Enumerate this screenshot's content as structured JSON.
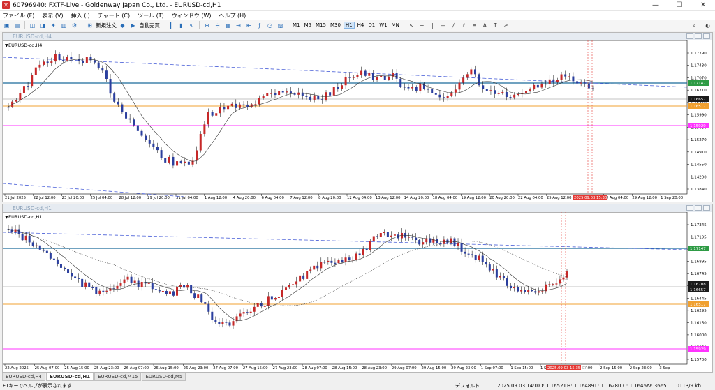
{
  "window": {
    "title": "60796940: FXTF-Live - Goldenway Japan Co., Ltd. - EURUSD-cd,H1",
    "controls": [
      "—",
      "☐",
      "✕"
    ]
  },
  "menu": [
    "ファイル (F)",
    "表示 (V)",
    "挿入 (I)",
    "チャート (C)",
    "ツール (T)",
    "ウィンドウ (W)",
    "ヘルプ (H)"
  ],
  "toolbar": {
    "new_order": "新規注文",
    "auto_trade": "自動売買",
    "timeframes": [
      "M1",
      "M5",
      "M15",
      "M30",
      "H1",
      "H4",
      "D1",
      "W1",
      "MN"
    ],
    "active_timeframe": "H1"
  },
  "colors": {
    "bull": "#c62828",
    "bear": "#2b3f9e",
    "resistance": "#1a6b9a",
    "support_orange": "#f0a030",
    "support_magenta": "#ff33ff",
    "trend": "#4a60d8",
    "price_tag": "#1b1b1b",
    "green_tag": "#2e9b45",
    "date_tag": "#e53935"
  },
  "charts": [
    {
      "window_title": "EURUSD-cd,H4",
      "label": "EURUSD-cd,H4",
      "yticks": [
        "1.17790",
        "1.17430",
        "1.17070",
        "1.16710",
        "1.16350",
        "1.15990",
        "1.15630",
        "1.15270",
        "1.14910",
        "1.14550",
        "1.14200",
        "1.13840"
      ],
      "price_tags": {
        "resistance": "1.17147",
        "current": "1.16657",
        "orange": "1.16517",
        "magenta": "1.15929"
      },
      "xticks": [
        "21 Jul 2025",
        "22 Jul 12:00",
        "23 Jul 20:00",
        "25 Jul 04:00",
        "28 Jul 12:00",
        "29 Jul 20:00",
        "31 Jul 04:00",
        "1 Aug 12:00",
        "4 Aug 20:00",
        "6 Aug 04:00",
        "7 Aug 12:00",
        "8 Aug 20:00",
        "12 Aug 04:00",
        "13 Aug 12:00",
        "14 Aug 20:00",
        "18 Aug 04:00",
        "19 Aug 12:00",
        "20 Aug 20:00",
        "22 Aug 04:00",
        "25 Aug 12:00",
        "26 Aug 20:00",
        "28 Aug 04:00",
        "29 Aug 12:00",
        "1 Sep 20:00"
      ],
      "date_tag": "2025.09.03 15:30:3"
    },
    {
      "window_title": "EURUSD-cd,H1",
      "label": "EURUSD-cd,H1",
      "yticks": [
        "1.17345",
        "1.17195",
        "1.17045",
        "1.16895",
        "1.16745",
        "1.16595",
        "1.16445",
        "1.16295",
        "1.16150",
        "1.16000",
        "1.15850",
        "1.15700"
      ],
      "price_tags": {
        "resistance": "1.17147",
        "current_a": "1.16708",
        "current_b": "1.16657",
        "orange": "1.16517",
        "magenta": "1.15929"
      },
      "xticks": [
        "22 Aug 2025",
        "25 Aug 07:00",
        "25 Aug 15:00",
        "25 Aug 23:00",
        "26 Aug 07:00",
        "26 Aug 15:00",
        "26 Aug 23:00",
        "27 Aug 07:00",
        "27 Aug 15:00",
        "27 Aug 23:00",
        "28 Aug 07:00",
        "28 Aug 15:00",
        "28 Aug 23:00",
        "29 Aug 07:00",
        "29 Aug 15:00",
        "29 Aug 23:00",
        "1 Sep 07:00",
        "1 Sep 15:00",
        "1 Sep 23:00",
        "2 Sep 07:00",
        "2 Sep 15:00",
        "2 Sep 23:00",
        "3 Sep"
      ],
      "date_tag": "2025.09.03 15:35:00"
    }
  ],
  "tabs": [
    "EURUSD-cd,H4",
    "EURUSD-cd,H1",
    "EURUSD-cd,M15",
    "EURUSD-cd,M5"
  ],
  "active_tab": "EURUSD-cd,H1",
  "status": {
    "help": "F1キーでヘルプが表示されます",
    "profile": "デフォルト",
    "datetime": "2025.09.03 14:00",
    "open": "O: 1.16521",
    "high": "H: 1.16489",
    "low": "L: 1.16280",
    "close": "C: 1.16466",
    "volume": "V: 3665",
    "memory": "10113/9 kb"
  }
}
